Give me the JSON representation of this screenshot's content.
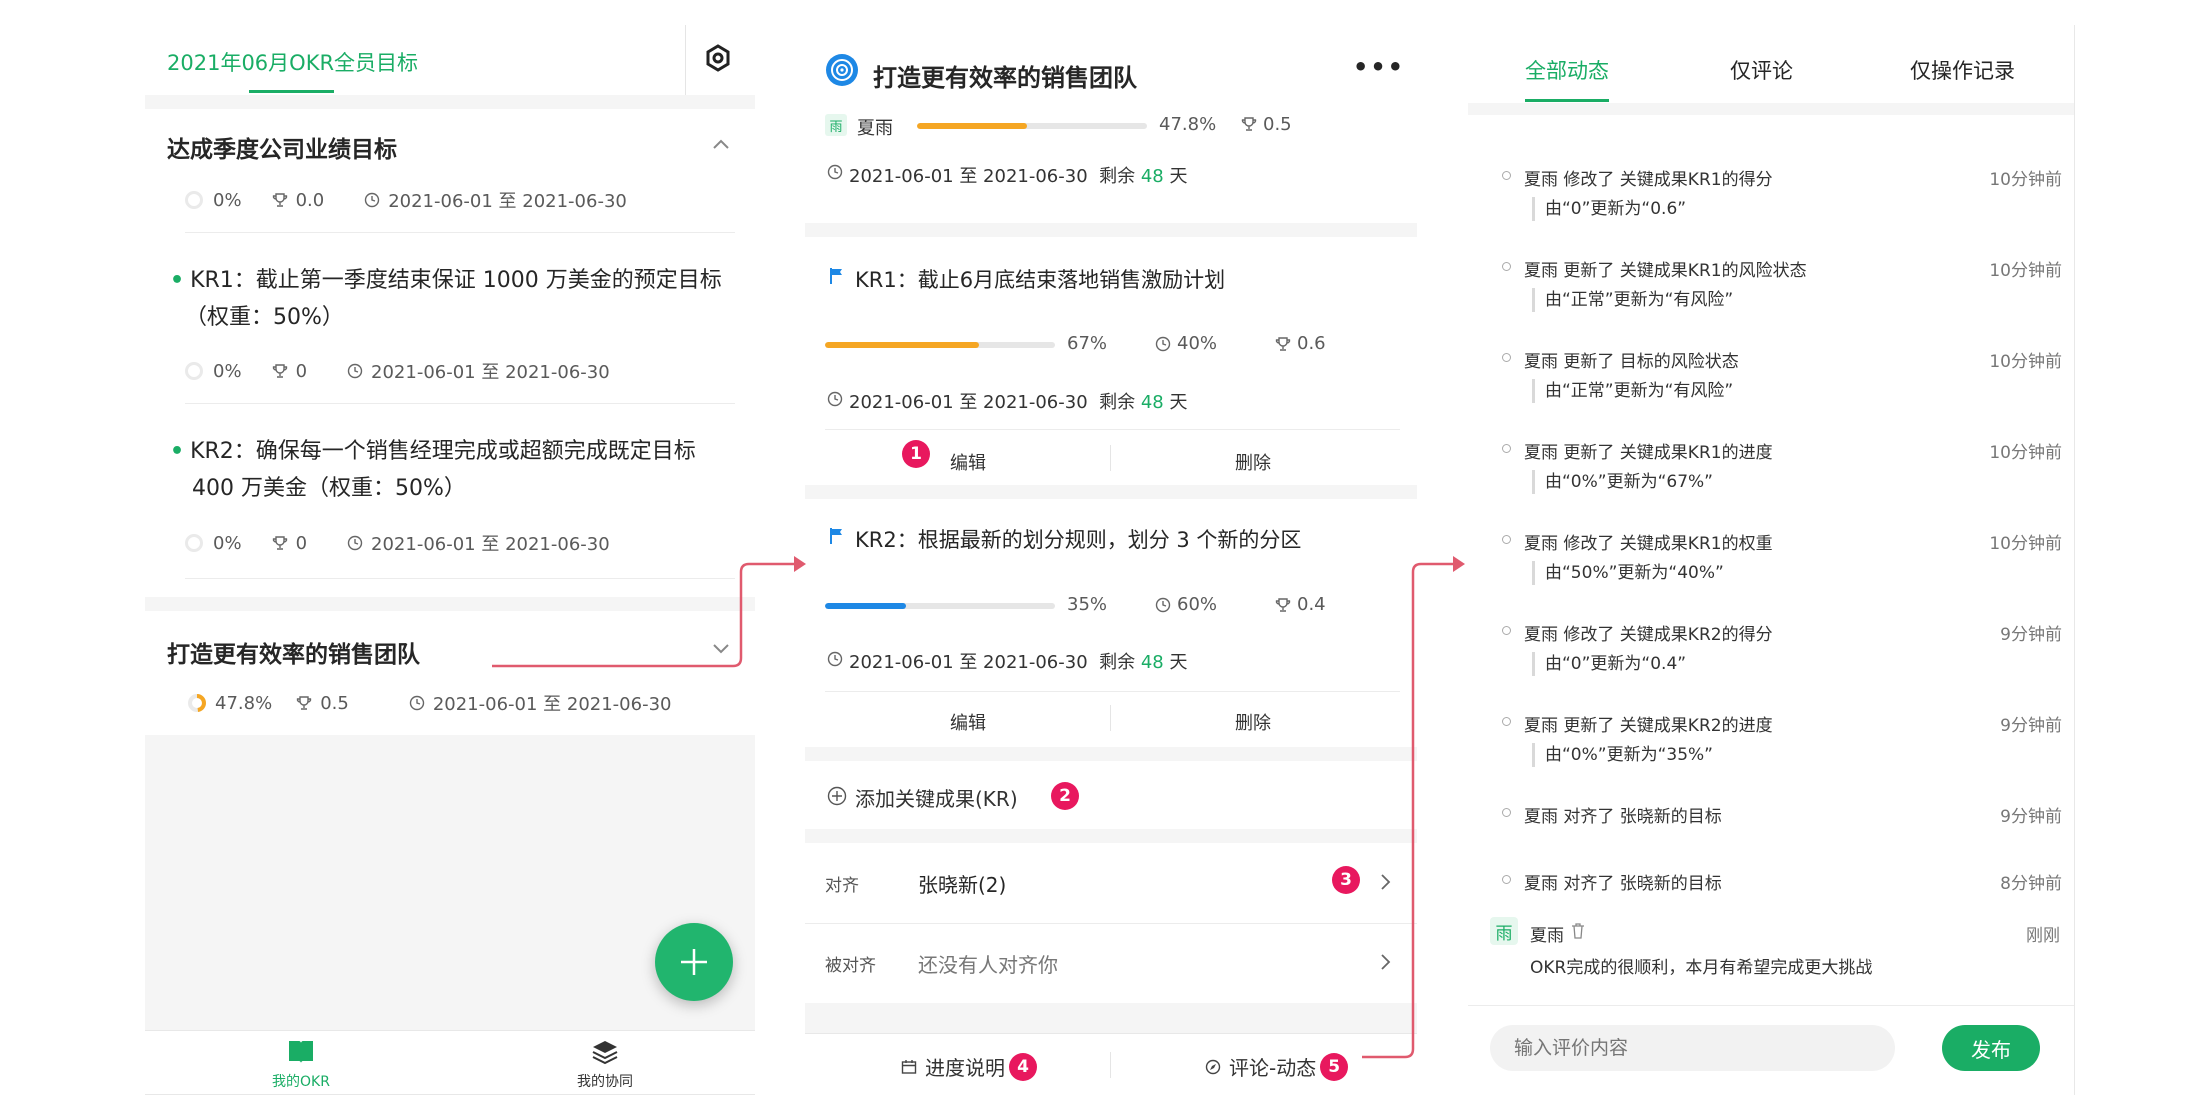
{
  "panel1": {
    "title": "2021年06月OKR全员目标",
    "objective1": {
      "title": "达成季度公司业绩目标",
      "progress": "0%",
      "score": "0.0",
      "dates": "2021-06-01 至 2021-06-30",
      "krs": [
        {
          "line1": "KR1：截止第一季度结束保证 1000 万美金的预定目标",
          "line2": "（权重：50%）",
          "progress": "0%",
          "score": "0",
          "dates": "2021-06-01 至 2021-06-30"
        },
        {
          "line1": "KR2：确保每一个销售经理完成或超额完成既定目标",
          "line2": "400 万美金（权重：50%）",
          "progress": "0%",
          "score": "0",
          "dates": "2021-06-01 至 2021-06-30"
        }
      ]
    },
    "objective2": {
      "title": "打造更有效率的销售团队",
      "progress": "47.8%",
      "progress_value": 47.8,
      "score": "0.5",
      "dates": "2021-06-01 至 2021-06-30"
    },
    "tabs": {
      "my_okr": "我的OKR",
      "my_collab": "我的协同"
    }
  },
  "panel2": {
    "title": "打造更有效率的销售团队",
    "owner_avatar": "雨",
    "owner": "夏雨",
    "progress": "47.8%",
    "progress_value": 47.8,
    "score": "0.5",
    "dates": "2021-06-01 至 2021-06-30",
    "remaining_label": "剩余",
    "remaining_days": "48",
    "days_unit": "天",
    "krs": [
      {
        "title": "KR1：截止6月底结束落地销售激励计划",
        "progress": "67%",
        "progress_value": 67,
        "bar_color": "#f5a623",
        "weight": "40%",
        "score": "0.6",
        "dates": "2021-06-01 至 2021-06-30",
        "remaining_days": "48",
        "edit": "编辑",
        "delete": "删除"
      },
      {
        "title": "KR2：根据最新的划分规则，划分 3 个新的分区",
        "progress": "35%",
        "progress_value": 35,
        "bar_color": "#1e88e5",
        "weight": "60%",
        "score": "0.4",
        "dates": "2021-06-01 至 2021-06-30",
        "remaining_days": "48",
        "edit": "编辑",
        "delete": "删除"
      }
    ],
    "add_kr": "添加关键成果(KR)",
    "align_label": "对齐",
    "align_value": "张晓新(2)",
    "aligned_label": "被对齐",
    "aligned_value": "还没有人对齐你",
    "progress_note": "进度说明",
    "comments": "评论-动态",
    "badges": [
      "1",
      "2",
      "3",
      "4",
      "5"
    ]
  },
  "panel3": {
    "tabs": [
      "全部动态",
      "仅评论",
      "仅操作记录"
    ],
    "feed": [
      {
        "text": "夏雨 修改了 关键成果KR1的得分",
        "sub": "由“0”更新为“0.6”",
        "time": "10分钟前"
      },
      {
        "text": "夏雨 更新了 关键成果KR1的风险状态",
        "sub": "由“正常”更新为“有风险”",
        "time": "10分钟前"
      },
      {
        "text": "夏雨 更新了 目标的风险状态",
        "sub": "由“正常”更新为“有风险”",
        "time": "10分钟前"
      },
      {
        "text": "夏雨 更新了 关键成果KR1的进度",
        "sub": "由“0%”更新为“67%”",
        "time": "10分钟前"
      },
      {
        "text": "夏雨 修改了 关键成果KR1的权重",
        "sub": "由“50%”更新为“40%”",
        "time": "10分钟前"
      },
      {
        "text": "夏雨 修改了 关键成果KR2的得分",
        "sub": "由“0”更新为“0.4”",
        "time": "9分钟前"
      },
      {
        "text": "夏雨 更新了 关键成果KR2的进度",
        "sub": "由“0%”更新为“35%”",
        "time": "9分钟前"
      },
      {
        "text": "夏雨 对齐了 张晓新的目标",
        "sub": "",
        "time": "9分钟前"
      },
      {
        "text": "夏雨 对齐了 张晓新的目标",
        "sub": "",
        "time": "8分钟前"
      }
    ],
    "comment": {
      "avatar": "雨",
      "author": "夏雨",
      "text": "OKR完成的很顺利，本月有希望完成更大挑战",
      "time": "刚刚"
    },
    "input_placeholder": "输入评价内容",
    "publish": "发布"
  },
  "colors": {
    "accent": "#1aad65",
    "badge": "#e8185e",
    "arrow": "#e05a6e",
    "orange": "#f5a623",
    "blue": "#1e88e5"
  }
}
